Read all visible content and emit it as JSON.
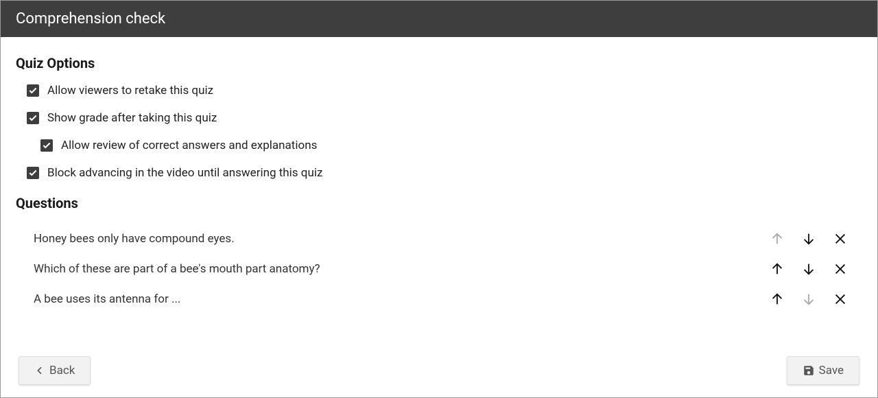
{
  "header": {
    "title": "Comprehension check"
  },
  "sections": {
    "options_title": "Quiz Options",
    "questions_title": "Questions"
  },
  "options": {
    "retake": {
      "label": "Allow viewers to retake this quiz",
      "checked": true
    },
    "show_grade": {
      "label": "Show grade after taking this quiz",
      "checked": true
    },
    "allow_review": {
      "label": "Allow review of correct answers and explanations",
      "checked": true
    },
    "block_advance": {
      "label": "Block advancing in the video until answering this quiz",
      "checked": true
    }
  },
  "questions": [
    {
      "text": "Honey bees only have compound eyes.",
      "can_up": false,
      "can_down": true
    },
    {
      "text": "Which of these are part of a bee's mouth part anatomy?",
      "can_up": true,
      "can_down": true
    },
    {
      "text": "A bee uses its antenna for ...",
      "can_up": true,
      "can_down": false
    }
  ],
  "footer": {
    "back_label": "Back",
    "save_label": "Save"
  }
}
